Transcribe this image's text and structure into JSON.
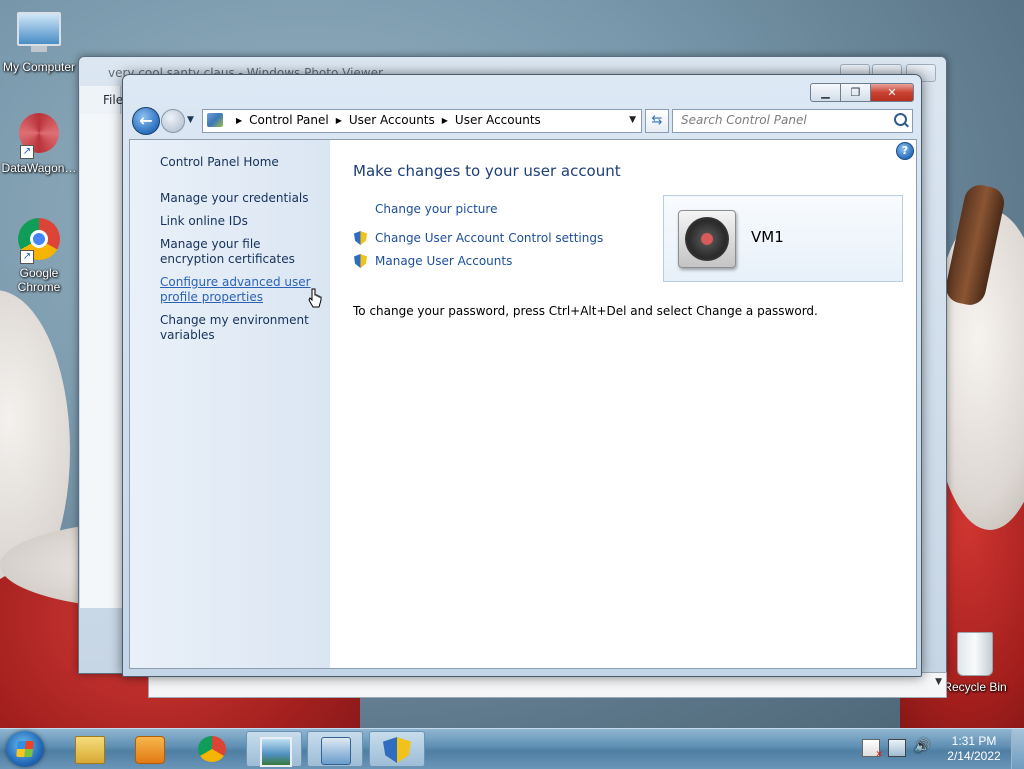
{
  "desktop": {
    "icons": [
      {
        "label": "My Computer",
        "icon": "computer-icon"
      },
      {
        "label": "DataWagon…",
        "icon": "datawagon-icon"
      },
      {
        "label": "Google Chrome",
        "icon": "chrome-icon"
      },
      {
        "label": "Recycle Bin",
        "icon": "recycle-bin-icon"
      }
    ]
  },
  "background_window": {
    "title": "very cool santy claus - Windows Photo Viewer",
    "menu_label": "File"
  },
  "control_panel": {
    "address": {
      "crumbs": [
        "Control Panel",
        "User Accounts",
        "User Accounts"
      ]
    },
    "search": {
      "placeholder": "Search Control Panel"
    },
    "sidebar": {
      "items": [
        {
          "label": "Control Panel Home"
        },
        {
          "label": "Manage your credentials"
        },
        {
          "label": "Link online IDs"
        },
        {
          "label": "Manage your file encryption certificates"
        },
        {
          "label": "Configure advanced user profile properties"
        },
        {
          "label": "Change my environment variables"
        }
      ]
    },
    "main": {
      "heading": "Make changes to your user account",
      "tasks": [
        {
          "label": "Change your picture",
          "shield": false
        },
        {
          "label": "Change User Account Control settings",
          "shield": true
        },
        {
          "label": "Manage User Accounts",
          "shield": true
        }
      ],
      "user_name": "VM1",
      "password_note": "To change your password, press Ctrl+Alt+Del and select Change a password."
    }
  },
  "taskbar": {
    "items": [
      "windows-explorer-icon",
      "media-player-icon",
      "chrome-icon",
      "photo-viewer-icon",
      "control-panel-icon",
      "security-shield-icon"
    ],
    "active_item": "control-panel-icon",
    "clock_time": "1:31 PM",
    "clock_date": "2/14/2022"
  },
  "colors": {
    "link": "#1c4e9c",
    "heading": "#1e3f78",
    "close_button": "#c94232"
  }
}
